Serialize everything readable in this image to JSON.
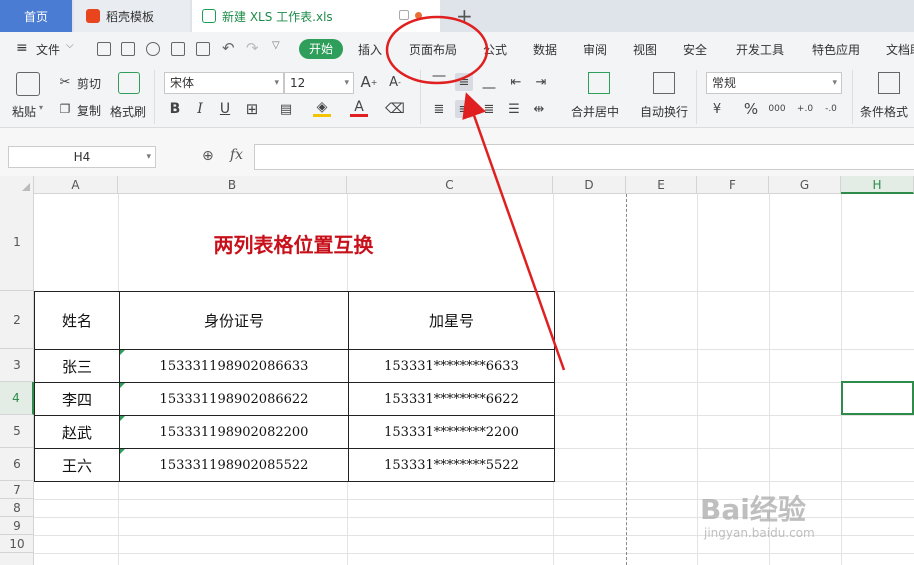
{
  "tabs": {
    "home": "首页",
    "template": "稻壳模板",
    "file": "新建 XLS 工作表.xls",
    "add": "+"
  },
  "menu": {
    "file": "文件",
    "start": "开始",
    "insert": "插入",
    "page_layout": "页面布局",
    "formula": "公式",
    "data": "数据",
    "review": "审阅",
    "view": "视图",
    "security": "安全",
    "developer": "开发工具",
    "special": "特色应用",
    "doc": "文档助"
  },
  "toolbar": {
    "paste": "粘贴",
    "cut": "剪切",
    "copy": "复制",
    "format_painter": "格式刷",
    "font_name": "宋体",
    "font_size": "12",
    "bold": "B",
    "italic": "I",
    "underline": "U",
    "merge_center": "合并居中",
    "wrap_text": "自动换行",
    "number_format": "常规",
    "percent": "%",
    "thousands": "000",
    "cond_format": "条件格式"
  },
  "formula_bar": {
    "name_box": "H4",
    "fx": "fx"
  },
  "columns": [
    "A",
    "B",
    "C",
    "D",
    "E",
    "F",
    "G",
    "H"
  ],
  "rows": [
    "1",
    "2",
    "3",
    "4",
    "5",
    "6",
    "7",
    "8",
    "9",
    "10"
  ],
  "selected": {
    "column": "H",
    "row": "4"
  },
  "sheet": {
    "title": "两列表格位置互换",
    "headers": [
      "姓名",
      "身份证号",
      "加星号"
    ],
    "data": [
      [
        "张三",
        "153331198902086633",
        "153331********6633"
      ],
      [
        "李四",
        "153331198902086622",
        "153331********6622"
      ],
      [
        "赵武",
        "153331198902082200",
        "153331********2200"
      ],
      [
        "王六",
        "153331198902085522",
        "153331********5522"
      ]
    ]
  },
  "watermark": {
    "text": "Bai经验",
    "sub": "jingyan.baidu.com"
  },
  "colors": {
    "accent_green": "#2e9e5a",
    "title_red": "#c8101a",
    "annotation_red": "#e02020"
  }
}
